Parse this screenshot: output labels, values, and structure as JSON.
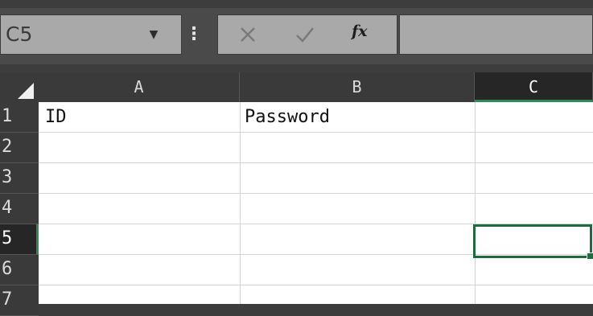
{
  "formula_bar": {
    "name_box": "C5",
    "cancel_icon": "x-icon",
    "enter_icon": "checkmark-icon",
    "fx_label": "fx",
    "formula_value": ""
  },
  "columns": [
    "A",
    "B",
    "C"
  ],
  "active_column": "C",
  "rows": [
    "1",
    "2",
    "3",
    "4",
    "5",
    "6",
    "7"
  ],
  "active_row": "5",
  "cells": {
    "A1": "ID",
    "B1": "Password"
  },
  "selected_cell": "C5",
  "colors": {
    "selection": "#1e6b3d",
    "header_bg": "#3a3a3a",
    "active_header_bg": "#262626"
  }
}
